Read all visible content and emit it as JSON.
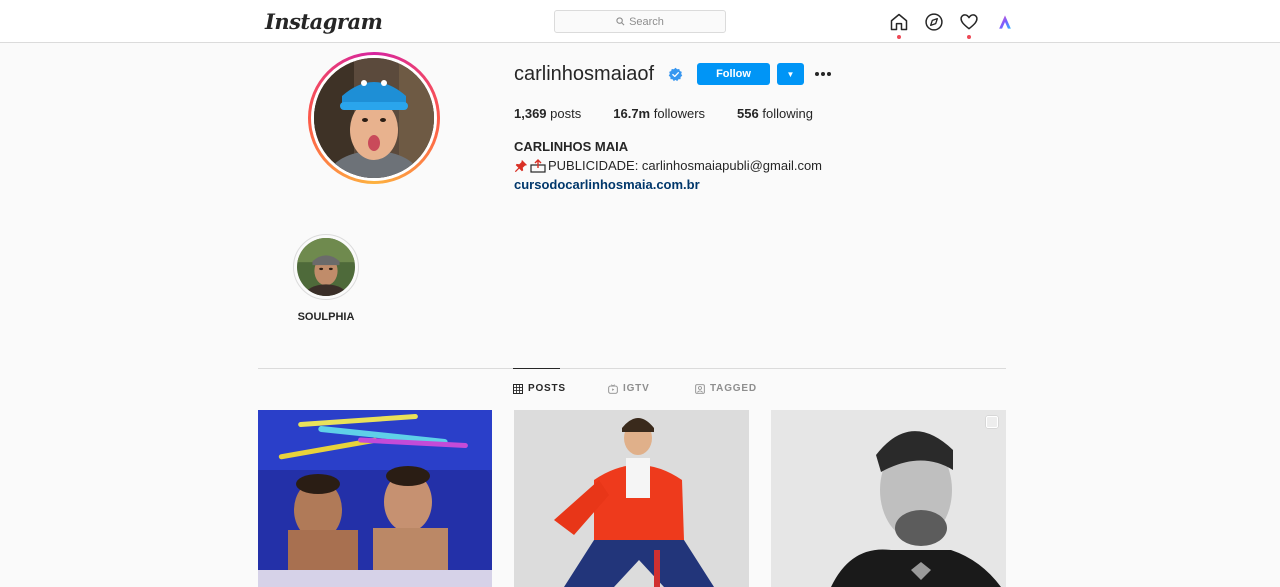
{
  "header": {
    "logo": "Instagram",
    "search_placeholder": "Search"
  },
  "profile": {
    "username": "carlinhosmaiaof",
    "follow_label": "Follow",
    "stats": {
      "posts_count": "1,369",
      "posts_label": "posts",
      "followers_count": "16.7m",
      "followers_label": "followers",
      "following_count": "556",
      "following_label": "following"
    },
    "full_name": "CARLINHOS MAIA",
    "bio_text": "PUBLICIDADE: carlinhosmaiapubli@gmail.com",
    "bio_emojis": [
      "pushpin",
      "outbox-tray"
    ],
    "link": "cursodocarlinhosmaia.com.br"
  },
  "highlights": [
    {
      "label": "SOULPHIA"
    }
  ],
  "tabs": [
    {
      "label": "POSTS",
      "icon": "grid-icon",
      "active": true
    },
    {
      "label": "IGTV",
      "icon": "igtv-icon",
      "active": false
    },
    {
      "label": "TAGGED",
      "icon": "tagged-icon",
      "active": false
    }
  ],
  "colors": {
    "accent": "#0095f6",
    "notification_dot": "#ed4956",
    "link": "#00376b"
  }
}
